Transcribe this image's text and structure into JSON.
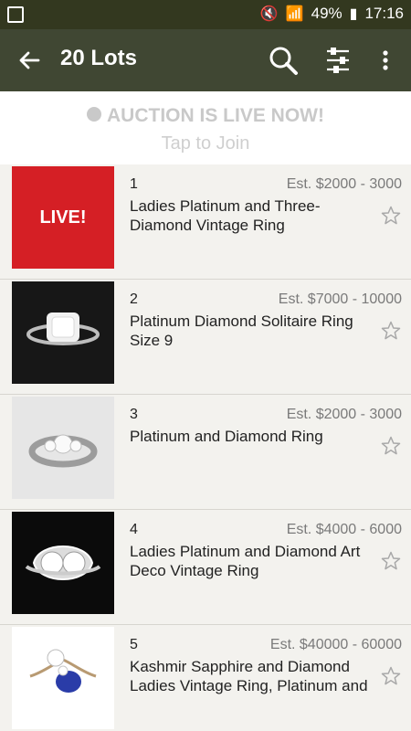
{
  "status_bar": {
    "battery_percent": "49%",
    "time": "17:16"
  },
  "toolbar": {
    "title": "20 Lots"
  },
  "banner": {
    "headline": "AUCTION IS LIVE NOW!",
    "subtext": "Tap to Join"
  },
  "lots": [
    {
      "number": "1",
      "estimate": "Est. $2000 - 3000",
      "title": "Ladies Platinum and Three-Diamond Vintage Ring",
      "thumbnail_badge": "LIVE!"
    },
    {
      "number": "2",
      "estimate": "Est. $7000 - 10000",
      "title": "Platinum Diamond Solitaire Ring Size 9"
    },
    {
      "number": "3",
      "estimate": "Est. $2000 - 3000",
      "title": "Platinum and Diamond Ring"
    },
    {
      "number": "4",
      "estimate": "Est. $4000 - 6000",
      "title": "Ladies Platinum and Diamond Art Deco Vintage Ring"
    },
    {
      "number": "5",
      "estimate": "Est. $40000 - 60000",
      "title": "Kashmir Sapphire and Diamond Ladies Vintage Ring, Platinum and"
    }
  ]
}
